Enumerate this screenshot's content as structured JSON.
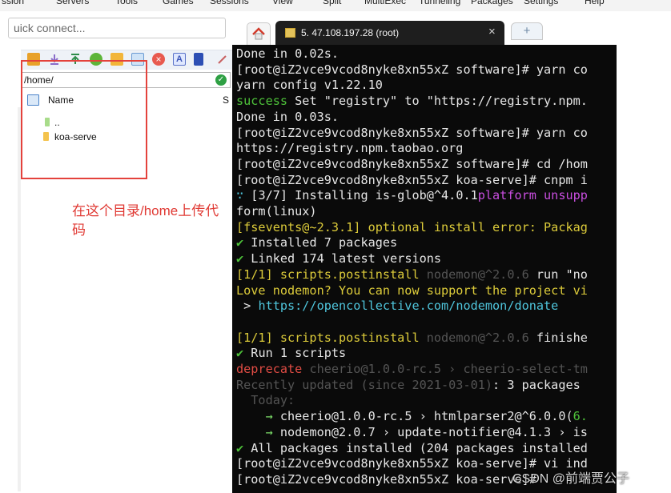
{
  "menubar": {
    "items": [
      "ssion",
      "Servers",
      "Tools",
      "Games",
      "Sessions",
      "View",
      "Split",
      "MultiExec",
      "Tunneling",
      "Packages",
      "Settings",
      "Help"
    ]
  },
  "left_panel": {
    "quick_connect_placeholder": "uick connect...",
    "path": "/home/",
    "column_name": "Name",
    "column_size": "S",
    "files": [
      "..",
      "koa-serve"
    ],
    "annotation": "在这个目录/home上传代码",
    "colors": {
      "annotation": "#e03a34",
      "box": "#e4423c"
    }
  },
  "tabs": {
    "session_label": "5. 47.108.197.28 (root)",
    "close_glyph": "×",
    "new_tab_glyph": "+"
  },
  "terminal": {
    "lines": [
      [
        {
          "t": "Done in 0.02s.",
          "c": "w"
        }
      ],
      [
        {
          "t": "[root@iZ2vce9vcod8nyke8xn55xZ software]# yarn co",
          "c": "w"
        }
      ],
      [
        {
          "t": "yarn config v1.22.10",
          "c": "w"
        }
      ],
      [
        {
          "t": "success",
          "c": "g"
        },
        {
          "t": " Set \"registry\" to \"https://registry.npm.",
          "c": "w"
        }
      ],
      [
        {
          "t": "Done in 0.03s.",
          "c": "w"
        }
      ],
      [
        {
          "t": "[root@iZ2vce9vcod8nyke8xn55xZ software]# yarn co",
          "c": "w"
        }
      ],
      [
        {
          "t": "https://registry.npm.taobao.org",
          "c": "w"
        }
      ],
      [
        {
          "t": "[root@iZ2vce9vcod8nyke8xn55xZ software]# cd /hom",
          "c": "w"
        }
      ],
      [
        {
          "t": "[root@iZ2vce9vcod8nyke8xn55xZ koa-serve]# cnpm i",
          "c": "w"
        }
      ],
      [
        {
          "t": "∵ ",
          "c": "c"
        },
        {
          "t": "[3/7] Installing is-glob@^4.0.1",
          "c": "w"
        },
        {
          "t": "platform unsupp",
          "c": "m"
        }
      ],
      [
        {
          "t": "form(linux)",
          "c": "w"
        }
      ],
      [
        {
          "t": "[fsevents@~2.3.1] optional install error: Packag",
          "c": "y"
        }
      ],
      [
        {
          "t": "✔ ",
          "c": "g"
        },
        {
          "t": "Installed 7 packages",
          "c": "w"
        }
      ],
      [
        {
          "t": "✔ ",
          "c": "g"
        },
        {
          "t": "Linked 174 latest versions",
          "c": "w"
        }
      ],
      [
        {
          "t": "[1/1] scripts.postinstall ",
          "c": "y"
        },
        {
          "t": "nodemon@^2.0.6",
          "c": "d"
        },
        {
          "t": " run \"no",
          "c": "w"
        }
      ],
      [
        {
          "t": "Love nodemon? You can now support the project vi",
          "c": "y"
        }
      ],
      [
        {
          "t": " > ",
          "c": "w"
        },
        {
          "t": "https://opencollective.com/nodemon/donate",
          "c": "c"
        }
      ],
      [
        {
          "t": "",
          "c": "w"
        }
      ],
      [
        {
          "t": "[1/1] scripts.postinstall ",
          "c": "y"
        },
        {
          "t": "nodemon@^2.0.6",
          "c": "d"
        },
        {
          "t": " finishe",
          "c": "w"
        }
      ],
      [
        {
          "t": "✔ ",
          "c": "g"
        },
        {
          "t": "Run 1 scripts",
          "c": "w"
        }
      ],
      [
        {
          "t": "deprecate ",
          "c": "r"
        },
        {
          "t": "cheerio@1.0.0-rc.5 › cheerio-select-tm",
          "c": "d"
        }
      ],
      [
        {
          "t": "Recently updated (since 2021-03-01)",
          "c": "d"
        },
        {
          "t": ": 3 packages",
          "c": "w"
        }
      ],
      [
        {
          "t": "  Today:",
          "c": "d"
        }
      ],
      [
        {
          "t": "    → ",
          "c": "bg"
        },
        {
          "t": "cheerio@1.0.0-rc.5 › htmlparser2@^6.0.0(",
          "c": "w"
        },
        {
          "t": "6.",
          "c": "g"
        }
      ],
      [
        {
          "t": "    → ",
          "c": "bg"
        },
        {
          "t": "nodemon@2.0.7 › update-notifier@4.1.3 › is",
          "c": "w"
        }
      ],
      [
        {
          "t": "✔ ",
          "c": "g"
        },
        {
          "t": "All packages installed (204 packages installed",
          "c": "w"
        }
      ],
      [
        {
          "t": "[root@iZ2vce9vcod8nyke8xn55xZ koa-serve]# vi ind",
          "c": "w"
        }
      ],
      [
        {
          "t": "[root@iZ2vce9vcod8nyke8xn55xZ koa-serve]# ",
          "c": "w"
        }
      ]
    ],
    "colors": {
      "background": "#0a0a0a",
      "success": "#4ec23a",
      "warning": "#dccb3a",
      "link": "#4fc5dc",
      "error": "#e14c44",
      "dim": "#545454",
      "platform": "#c94ee0"
    }
  },
  "watermark": "CSDN @前端贾公子",
  "icons": [
    "upload-icon",
    "download-icon",
    "upload-arrow-icon",
    "refresh-icon",
    "new-folder-icon",
    "new-file-icon",
    "delete-icon",
    "text-icon",
    "bookmark-icon",
    "tool-icon",
    "check-icon",
    "home-icon",
    "terminal-icon",
    "plus-icon",
    "folder-icon",
    "image-icon"
  ]
}
